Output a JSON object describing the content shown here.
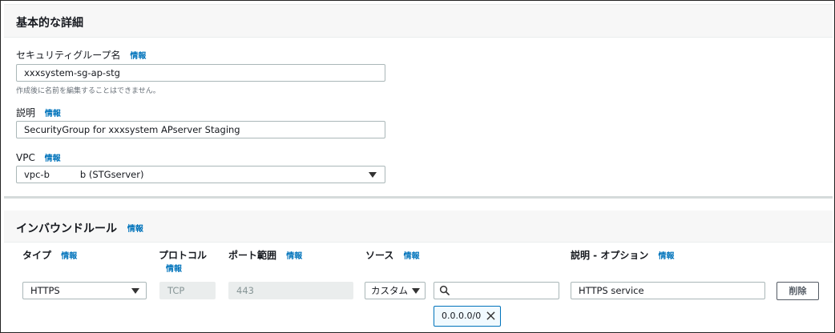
{
  "basic": {
    "title": "基本的な詳細",
    "info": "情報",
    "sg_name_label": "セキュリティグループ名",
    "sg_name_value": "xxxsystem-sg-ap-stg",
    "sg_name_hint": "作成後に名前を編集することはできません。",
    "description_label": "説明",
    "description_value": "SecurityGroup for xxxsystem APserver Staging",
    "vpc_label": "VPC",
    "vpc_value_prefix": "vpc-b",
    "vpc_value_suffix": "b (STGserver)"
  },
  "inbound": {
    "title": "インバウンドルール",
    "info": "情報",
    "columns": {
      "type": "タイプ",
      "protocol": "プロトコル",
      "port_range": "ポート範囲",
      "source": "ソース",
      "description": "説明 - オプション"
    },
    "rule": {
      "type": "HTTPS",
      "protocol": "TCP",
      "port_range": "443",
      "source_type": "カスタム",
      "source_search": "",
      "source_token": "0.0.0.0/0",
      "description": "HTTPS service",
      "delete_label": "削除"
    }
  },
  "icons": {
    "dropdown": "caret-down-icon",
    "search": "search-icon",
    "remove": "close-icon"
  },
  "colors": {
    "link": "#0073bb",
    "border": "#aab7b8",
    "header_bg": "#f7f7f7"
  }
}
